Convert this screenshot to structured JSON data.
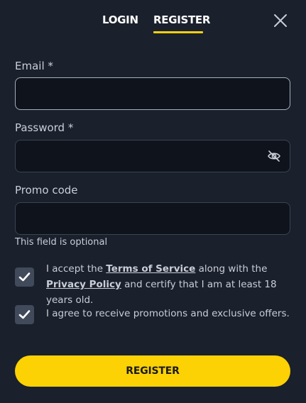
{
  "tabs": {
    "login": "LOGIN",
    "register": "REGISTER",
    "active": "register"
  },
  "form": {
    "email_label": "Email *",
    "email_value": "",
    "password_label": "Password *",
    "password_value": "",
    "promo_label": "Promo code",
    "promo_value": "",
    "promo_hint": "This field is optional"
  },
  "consent": {
    "terms": {
      "checked": true,
      "prefix": "I accept the ",
      "terms_link": "Terms of Service",
      "middle": " along with the ",
      "privacy_link": "Privacy Policy",
      "suffix": " and certify that I am at least 18 years old."
    },
    "promotions": {
      "checked": true,
      "text": "I agree to receive promotions and exclusive offers."
    }
  },
  "submit_label": "REGISTER",
  "icons": {
    "close": "close-icon",
    "password_visibility": "eye-off-icon",
    "checkbox_mark": "checkmark-icon"
  },
  "colors": {
    "background": "#1a202c",
    "accent": "#fcd205",
    "input_bg": "#0f141c",
    "checkbox_bg": "#414a5a"
  }
}
